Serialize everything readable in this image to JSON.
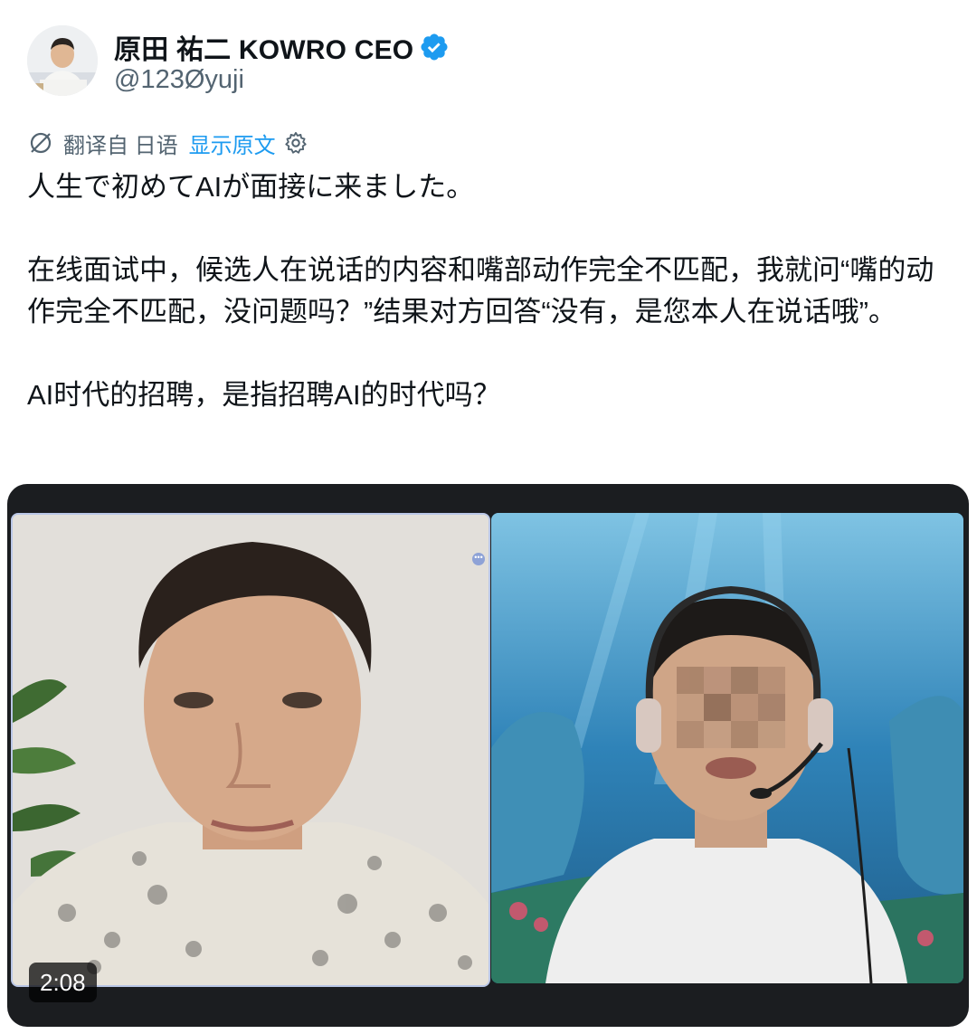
{
  "author": {
    "display_name": "原田 祐二 KOWRO CEO",
    "handle": "@123Øyuji",
    "verified": true,
    "verified_color": "#1d9bf0"
  },
  "translation": {
    "icon": "translate-icon",
    "source_label": "翻译自 日语",
    "show_original_label": "显示原文",
    "settings_icon": "gear-icon",
    "link_color": "#1d9bf0"
  },
  "post": {
    "lines": [
      "人生で初めてAIが面接に来ました。",
      "在线面试中，候选人在说话的内容和嘴部动作完全不匹配，我就问“嘴的动作完全不匹配，没问题吗？”结果对方回答“没有，是您本人在说话哦”。",
      "AI时代的招聘，是指招聘AI的时代吗？"
    ]
  },
  "media": {
    "duration": "2:08",
    "type": "video",
    "background": "#1b1d20"
  }
}
